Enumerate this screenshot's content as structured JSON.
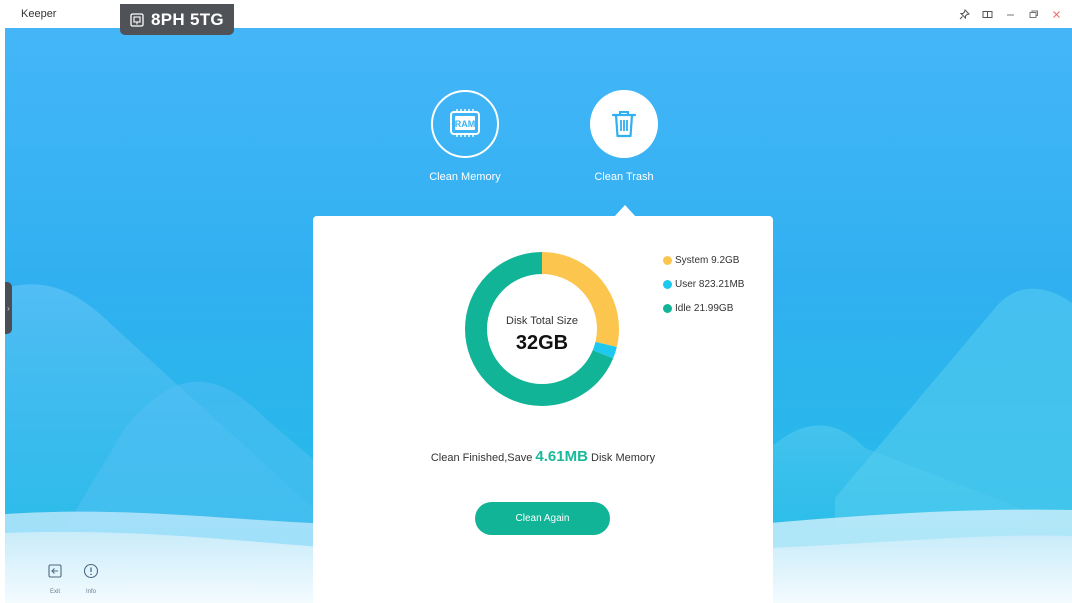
{
  "app": {
    "title": "Keeper",
    "badge_text": "8PH 5TG"
  },
  "modes": [
    {
      "label": "Clean Memory",
      "icon": "ram-chip-icon",
      "chip_text": "RAM",
      "selected": false
    },
    {
      "label": "Clean Trash",
      "icon": "trash-icon",
      "selected": true
    }
  ],
  "disk": {
    "caption": "Disk Total Size",
    "total": "32GB",
    "legend": [
      {
        "label": "System 9.2GB",
        "color": "#fcc54d"
      },
      {
        "label": "User 823.21MB",
        "color": "#1ec8ef"
      },
      {
        "label": "Idle 21.99GB",
        "color": "#12b497"
      }
    ]
  },
  "chart_data": {
    "type": "pie",
    "categories": [
      "System",
      "User",
      "Idle"
    ],
    "values": [
      9.2,
      0.8,
      21.99
    ],
    "units": "GB",
    "colors": [
      "#fcc54d",
      "#1ec8ef",
      "#12b497"
    ]
  },
  "result": {
    "prefix": "Clean Finished,Save",
    "value": "4.61MB",
    "suffix": "Disk Memory"
  },
  "actions": {
    "clean_again": "Clean Again"
  },
  "tools": [
    {
      "label": "Exit",
      "icon": "exit-icon"
    },
    {
      "label": "Info",
      "icon": "info-icon"
    }
  ]
}
